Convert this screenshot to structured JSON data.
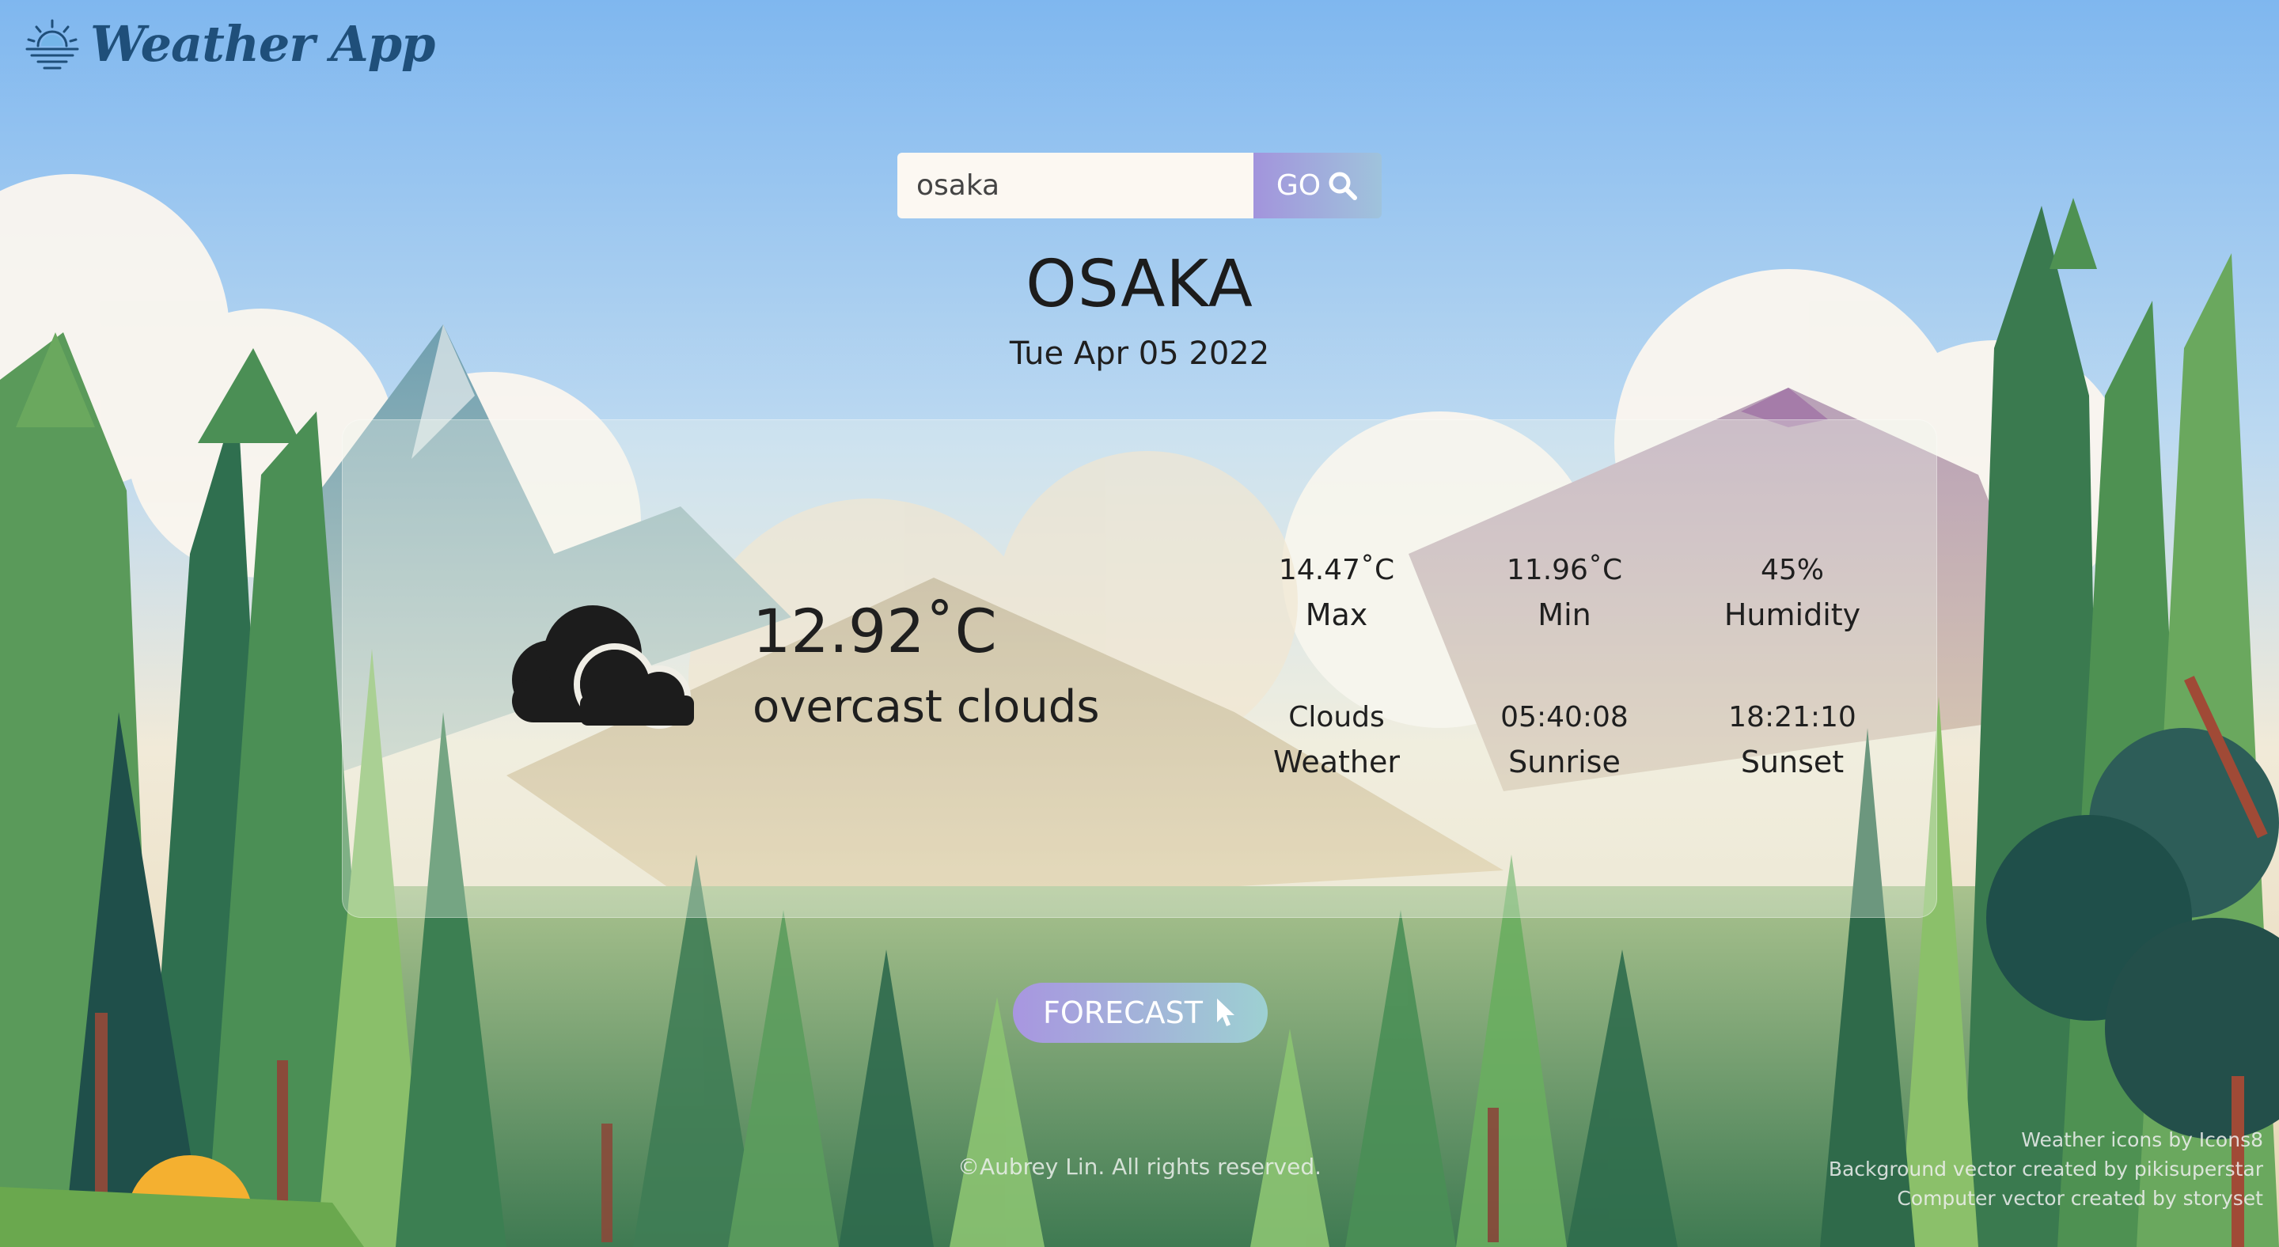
{
  "app": {
    "title": "Weather App",
    "logo_icon": "sun-horizon-icon"
  },
  "search": {
    "value": "osaka",
    "button_label": "GO",
    "button_icon": "search-icon"
  },
  "location": {
    "city": "OSAKA",
    "date": "Tue Apr 05 2022"
  },
  "current": {
    "icon": "cloud-icon",
    "temperature": "12.92˚C",
    "description": "overcast clouds"
  },
  "stats": [
    {
      "value": "14.47˚C",
      "label": "Max"
    },
    {
      "value": "11.96˚C",
      "label": "Min"
    },
    {
      "value": "45%",
      "label": "Humidity"
    },
    {
      "value": "Clouds",
      "label": "Weather"
    },
    {
      "value": "05:40:08",
      "label": "Sunrise"
    },
    {
      "value": "18:21:10",
      "label": "Sunset"
    }
  ],
  "forecast": {
    "label": "FORECAST",
    "icon": "cursor-icon"
  },
  "footer": {
    "copyright": "©Aubrey Lin. All rights reserved.",
    "credits": [
      "Weather icons by Icons8",
      "Background vector created by pikisuperstar",
      "Computer vector created by storyset"
    ]
  },
  "colors": {
    "sky_top": "#7fb7ef",
    "logo_text": "#1f4f7a",
    "button_gradient_start": "#a294dc",
    "button_gradient_end": "#9fc3dc"
  }
}
